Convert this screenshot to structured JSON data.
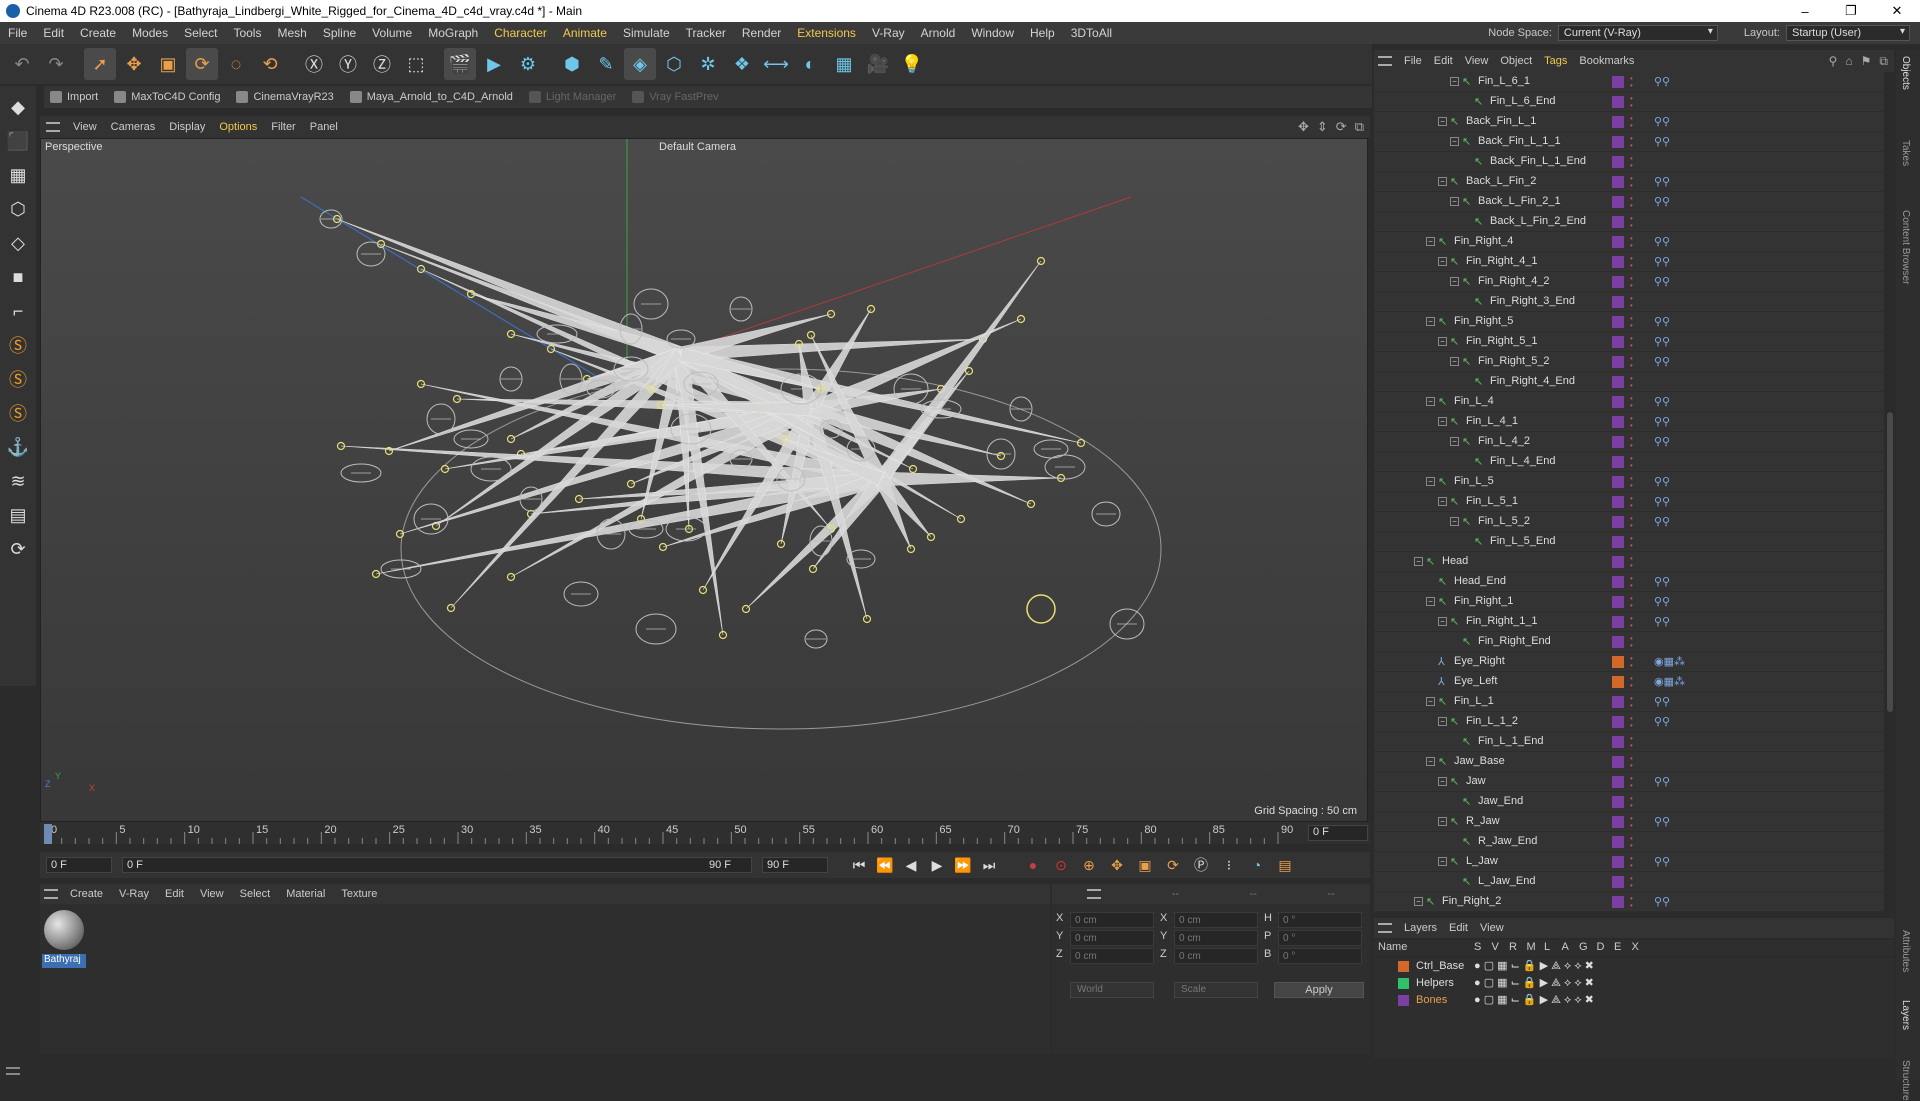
{
  "window": {
    "title": "Cinema 4D R23.008 (RC) - [Bathyraja_Lindbergi_White_Rigged_for_Cinema_4D_c4d_vray.c4d *] - Main",
    "controls": [
      "–",
      "❐",
      "✕"
    ]
  },
  "menubar": {
    "items": [
      "File",
      "Edit",
      "Create",
      "Modes",
      "Select",
      "Tools",
      "Mesh",
      "Spline",
      "Volume",
      "MoGraph",
      "Character",
      "Animate",
      "Simulate",
      "Tracker",
      "Render",
      "Extensions",
      "V-Ray",
      "Arnold",
      "Window",
      "Help",
      "3DToAll"
    ],
    "highlighted": [
      "Character",
      "Animate",
      "Extensions"
    ],
    "node_space_label": "Node Space:",
    "node_space_value": "Current (V-Ray)",
    "layout_label": "Layout:",
    "layout_value": "Startup (User)"
  },
  "toolbar": {
    "icons": [
      "undo-icon",
      "redo-icon",
      "select-cursor-icon",
      "move-icon",
      "scale-icon",
      "rotate-icon",
      "live-select-icon",
      "rotate-alt-icon",
      "x-axis-icon",
      "y-axis-icon",
      "z-axis-icon",
      "coordinate-system-icon",
      "render-view-icon",
      "render-picture-viewer-icon",
      "render-settings-icon",
      "cube-icon",
      "pen-icon",
      "subdivision-icon",
      "extrude-icon",
      "cloner-icon",
      "array-icon",
      "symmetry-icon",
      "deformer-icon",
      "floor-icon",
      "camera-icon",
      "light-icon"
    ],
    "glyphs": [
      "↶",
      "↷",
      "➚",
      "✥",
      "▣",
      "⟳",
      "◌",
      "⟲",
      "Ⓧ",
      "Ⓨ",
      "Ⓩ",
      "⬚",
      "🎬",
      "▶",
      "⚙",
      "⬢",
      "✎",
      "◈",
      "⬡",
      "✲",
      "❖",
      "⟷",
      "◐",
      "▦",
      "🎥",
      "💡"
    ]
  },
  "pluginbar": {
    "items": [
      {
        "label": "Import",
        "disabled": false
      },
      {
        "label": "MaxToC4D Config",
        "disabled": false
      },
      {
        "label": "CinemaVrayR23",
        "disabled": false
      },
      {
        "label": "Maya_Arnold_to_C4D_Arnold",
        "disabled": false
      },
      {
        "label": "Light Manager",
        "disabled": true
      },
      {
        "label": "Vray FastPrev",
        "disabled": true
      }
    ]
  },
  "lefttools": {
    "icons": [
      "make-editable-icon",
      "model-mode-icon",
      "texture-mode-icon",
      "points-mode-icon",
      "edges-mode-icon",
      "polygons-mode-icon",
      "object-axis-icon",
      "snap-icon",
      "soft-selection-icon",
      "tweak-icon",
      "magnet-icon",
      "workplane-icon",
      "grid-icon",
      "quantize-icon"
    ],
    "glyphs": [
      "◆",
      "⬛",
      "▦",
      "⬡",
      "◇",
      "■",
      "⌐",
      "Ⓢ",
      "Ⓢ",
      "Ⓢ",
      "⚓",
      "≋",
      "▤",
      "⟳"
    ]
  },
  "viewport": {
    "menu": [
      "View",
      "Cameras",
      "Display",
      "Options",
      "Filter",
      "Panel"
    ],
    "highlighted": [
      "Options"
    ],
    "label_perspective": "Perspective",
    "label_camera": "Default Camera",
    "grid_spacing": "Grid Spacing : 50 cm",
    "axis_x": "X",
    "axis_y": "Y",
    "axis_z": "Z"
  },
  "timeline": {
    "ticks": [
      "0",
      "5",
      "10",
      "15",
      "20",
      "25",
      "30",
      "35",
      "40",
      "45",
      "50",
      "55",
      "60",
      "65",
      "70",
      "75",
      "80",
      "85",
      "90"
    ],
    "current_frame": "0 F"
  },
  "playback": {
    "start_frame": "0 F",
    "range_start": "0 F",
    "range_end": "90 F",
    "end_frame": "90 F",
    "buttons": [
      "⏮",
      "⏪",
      "◀",
      "▶",
      "⏩",
      "⏭"
    ],
    "button_names": [
      "goto-start-button",
      "prev-key-button",
      "prev-frame-button",
      "play-button",
      "next-frame-button",
      "goto-end-button"
    ],
    "key_buttons": [
      "●",
      "⊙",
      "⊕",
      "✥",
      "▣",
      "⟳",
      "Ⓟ",
      "⁝",
      "◔",
      "▤"
    ]
  },
  "material": {
    "menu": [
      "Create",
      "V-Ray",
      "Edit",
      "View",
      "Select",
      "Material",
      "Texture"
    ],
    "items": [
      {
        "label": "Bathyraj"
      }
    ]
  },
  "coordinates": {
    "menu": [
      "--",
      "--",
      "--"
    ],
    "rows": [
      {
        "a_label": "X",
        "a_val": "0 cm",
        "b_label": "X",
        "b_val": "0 cm",
        "c_label": "H",
        "c_val": "0 °"
      },
      {
        "a_label": "Y",
        "a_val": "0 cm",
        "b_label": "Y",
        "b_val": "0 cm",
        "c_label": "P",
        "c_val": "0 °"
      },
      {
        "a_label": "Z",
        "a_val": "0 cm",
        "b_label": "Z",
        "b_val": "0 cm",
        "c_label": "B",
        "c_val": "0 °"
      }
    ],
    "mode_a": "World",
    "mode_b": "Scale",
    "apply": "Apply"
  },
  "objects": {
    "menu": [
      "File",
      "Edit",
      "View",
      "Object",
      "Tags",
      "Bookmarks"
    ],
    "highlighted": [
      "Tags"
    ],
    "rows": [
      {
        "name": "Fin_L_6_1",
        "depth": 4,
        "exp": true,
        "tag": "⚲⚲",
        "swatch": "#7a3fa0"
      },
      {
        "name": "Fin_L_6_End",
        "depth": 5,
        "exp": false,
        "tag": "",
        "swatch": "#7a3fa0"
      },
      {
        "name": "Back_Fin_L_1",
        "depth": 3,
        "exp": true,
        "tag": "⚲⚲",
        "swatch": "#7a3fa0"
      },
      {
        "name": "Back_Fin_L_1_1",
        "depth": 4,
        "exp": true,
        "tag": "⚲⚲",
        "swatch": "#7a3fa0"
      },
      {
        "name": "Back_Fin_L_1_End",
        "depth": 5,
        "exp": false,
        "tag": "",
        "swatch": "#7a3fa0"
      },
      {
        "name": "Back_L_Fin_2",
        "depth": 3,
        "exp": true,
        "tag": "⚲⚲",
        "swatch": "#7a3fa0"
      },
      {
        "name": "Back_L_Fin_2_1",
        "depth": 4,
        "exp": true,
        "tag": "⚲⚲",
        "swatch": "#7a3fa0"
      },
      {
        "name": "Back_L_Fin_2_End",
        "depth": 5,
        "exp": false,
        "tag": "",
        "swatch": "#7a3fa0"
      },
      {
        "name": "Fin_Right_4",
        "depth": 2,
        "exp": true,
        "tag": "⚲⚲",
        "swatch": "#7a3fa0"
      },
      {
        "name": "Fin_Right_4_1",
        "depth": 3,
        "exp": true,
        "tag": "⚲⚲",
        "swatch": "#7a3fa0"
      },
      {
        "name": "Fin_Right_4_2",
        "depth": 4,
        "exp": true,
        "tag": "⚲⚲",
        "swatch": "#7a3fa0"
      },
      {
        "name": "Fin_Right_3_End",
        "depth": 5,
        "exp": false,
        "tag": "",
        "swatch": "#7a3fa0"
      },
      {
        "name": "Fin_Right_5",
        "depth": 2,
        "exp": true,
        "tag": "⚲⚲",
        "swatch": "#7a3fa0"
      },
      {
        "name": "Fin_Right_5_1",
        "depth": 3,
        "exp": true,
        "tag": "⚲⚲",
        "swatch": "#7a3fa0"
      },
      {
        "name": "Fin_Right_5_2",
        "depth": 4,
        "exp": true,
        "tag": "⚲⚲",
        "swatch": "#7a3fa0"
      },
      {
        "name": "Fin_Right_4_End",
        "depth": 5,
        "exp": false,
        "tag": "",
        "swatch": "#7a3fa0"
      },
      {
        "name": "Fin_L_4",
        "depth": 2,
        "exp": true,
        "tag": "⚲⚲",
        "swatch": "#7a3fa0"
      },
      {
        "name": "Fin_L_4_1",
        "depth": 3,
        "exp": true,
        "tag": "⚲⚲",
        "swatch": "#7a3fa0"
      },
      {
        "name": "Fin_L_4_2",
        "depth": 4,
        "exp": true,
        "tag": "⚲⚲",
        "swatch": "#7a3fa0"
      },
      {
        "name": "Fin_L_4_End",
        "depth": 5,
        "exp": false,
        "tag": "",
        "swatch": "#7a3fa0"
      },
      {
        "name": "Fin_L_5",
        "depth": 2,
        "exp": true,
        "tag": "⚲⚲",
        "swatch": "#7a3fa0"
      },
      {
        "name": "Fin_L_5_1",
        "depth": 3,
        "exp": true,
        "tag": "⚲⚲",
        "swatch": "#7a3fa0"
      },
      {
        "name": "Fin_L_5_2",
        "depth": 4,
        "exp": true,
        "tag": "⚲⚲",
        "swatch": "#7a3fa0"
      },
      {
        "name": "Fin_L_5_End",
        "depth": 5,
        "exp": false,
        "tag": "",
        "swatch": "#7a3fa0"
      },
      {
        "name": "Head",
        "depth": 1,
        "exp": true,
        "tag": "",
        "swatch": "#7a3fa0"
      },
      {
        "name": "Head_End",
        "depth": 2,
        "exp": false,
        "tag": "⚲⚲",
        "swatch": "#7a3fa0"
      },
      {
        "name": "Fin_Right_1",
        "depth": 2,
        "exp": true,
        "tag": "⚲⚲",
        "swatch": "#7a3fa0"
      },
      {
        "name": "Fin_Right_1_1",
        "depth": 3,
        "exp": true,
        "tag": "⚲⚲",
        "swatch": "#7a3fa0"
      },
      {
        "name": "Fin_Right_End",
        "depth": 4,
        "exp": false,
        "tag": "",
        "swatch": "#7a3fa0"
      },
      {
        "name": "Eye_Right",
        "depth": 2,
        "exp": false,
        "tag": "◉▦⁂",
        "swatch": "#d2692a"
      },
      {
        "name": "Eye_Left",
        "depth": 2,
        "exp": false,
        "tag": "◉▦⁂",
        "swatch": "#d2692a"
      },
      {
        "name": "Fin_L_1",
        "depth": 2,
        "exp": true,
        "tag": "⚲⚲",
        "swatch": "#7a3fa0"
      },
      {
        "name": "Fin_L_1_2",
        "depth": 3,
        "exp": true,
        "tag": "⚲⚲",
        "swatch": "#7a3fa0"
      },
      {
        "name": "Fin_L_1_End",
        "depth": 4,
        "exp": false,
        "tag": "",
        "swatch": "#7a3fa0"
      },
      {
        "name": "Jaw_Base",
        "depth": 2,
        "exp": true,
        "tag": "",
        "swatch": "#7a3fa0"
      },
      {
        "name": "Jaw",
        "depth": 3,
        "exp": true,
        "tag": "⚲⚲",
        "swatch": "#7a3fa0"
      },
      {
        "name": "Jaw_End",
        "depth": 4,
        "exp": false,
        "tag": "",
        "swatch": "#7a3fa0"
      },
      {
        "name": "R_Jaw",
        "depth": 3,
        "exp": true,
        "tag": "⚲⚲",
        "swatch": "#7a3fa0"
      },
      {
        "name": "R_Jaw_End",
        "depth": 4,
        "exp": false,
        "tag": "",
        "swatch": "#7a3fa0"
      },
      {
        "name": "L_Jaw",
        "depth": 3,
        "exp": true,
        "tag": "⚲⚲",
        "swatch": "#7a3fa0"
      },
      {
        "name": "L_Jaw_End",
        "depth": 4,
        "exp": false,
        "tag": "",
        "swatch": "#7a3fa0"
      },
      {
        "name": "Fin_Right_2",
        "depth": 1,
        "exp": true,
        "tag": "⚲⚲",
        "swatch": "#7a3fa0"
      }
    ]
  },
  "vtabs": [
    "Objects",
    "Takes",
    "Content Browser",
    "Attributes",
    "Layers",
    "Structure"
  ],
  "layers": {
    "menu": [
      "Layers",
      "Edit",
      "View"
    ],
    "columns": [
      "Name",
      "S",
      "V",
      "R",
      "M",
      "L",
      "A",
      "G",
      "D",
      "E",
      "X"
    ],
    "rows": [
      {
        "name": "Ctrl_Base",
        "color": "#d2692a",
        "highlight": false
      },
      {
        "name": "Helpers",
        "color": "#2fc06a",
        "highlight": false
      },
      {
        "name": "Bones",
        "color": "#7a3fa0",
        "highlight": true
      }
    ],
    "row_icons": "● ▢ ▦ ⌙ 🔒 ▶ ⟁ ⟡ ⟡ ✖"
  },
  "colors": {
    "accent_yellow": "#f2c94c",
    "highlight_orange": "#e8a04a",
    "bone_green": "#5cc05c"
  }
}
